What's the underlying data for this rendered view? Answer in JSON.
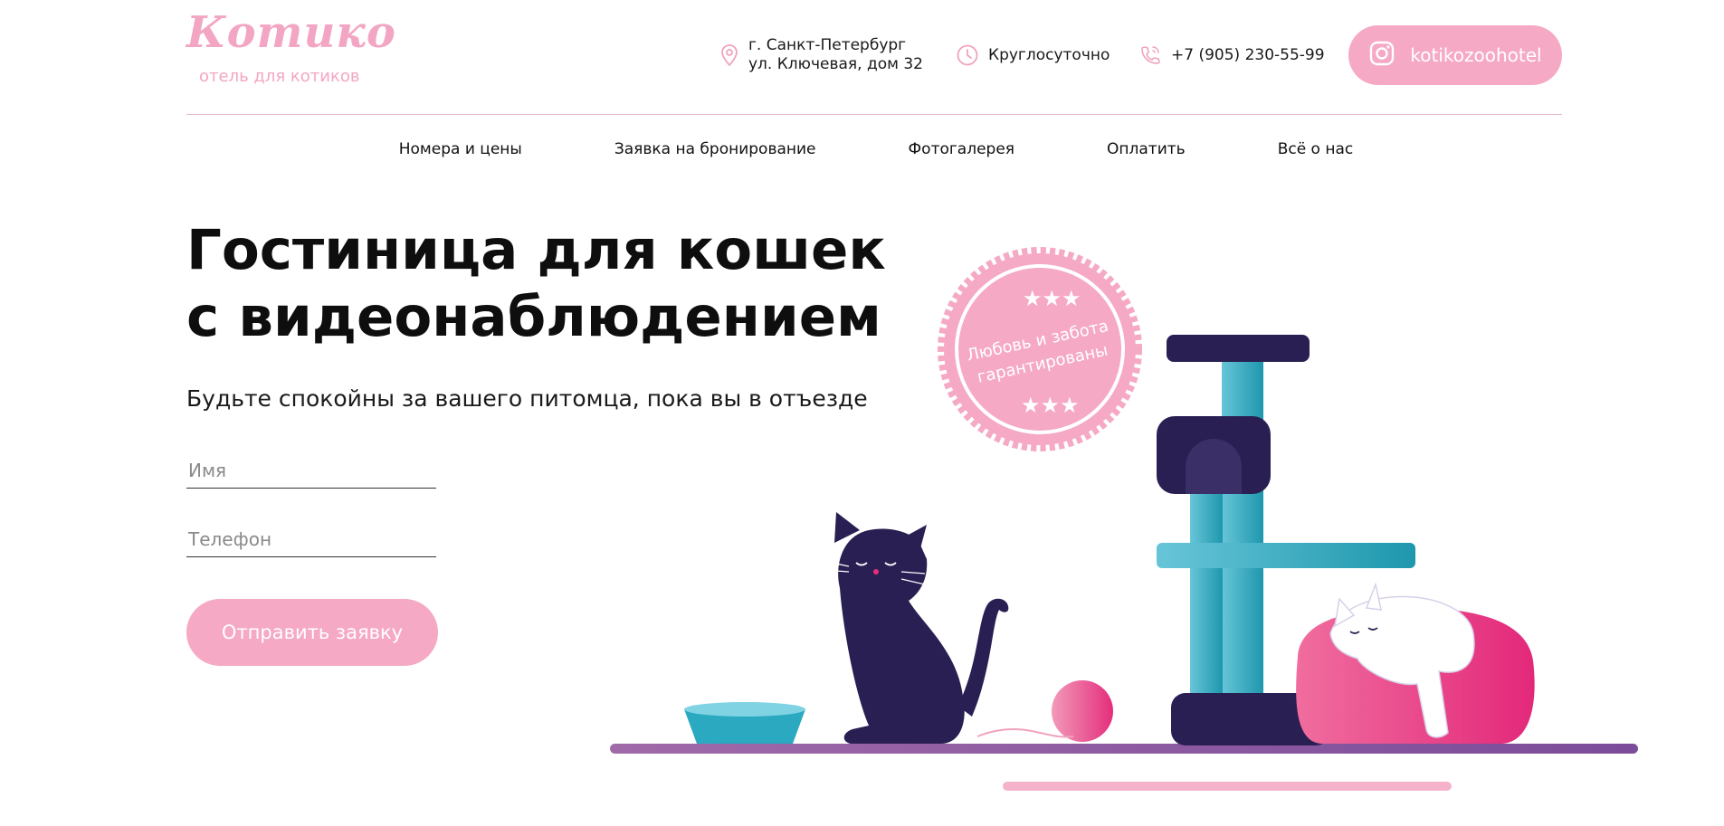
{
  "header": {
    "logo_title": "Котико",
    "logo_subtitle": "отель для котиков",
    "address_line1": "г. Санкт-Петербург",
    "address_line2": "ул. Ключевая, дом 32",
    "hours": "Круглосуточно",
    "phone": "+7 (905) 230-55-99",
    "instagram": "kotikozoohotel"
  },
  "nav": {
    "items": [
      "Номера и цены",
      "Заявка на бронирование",
      "Фотогалерея",
      "Оплатить",
      "Всё о нас"
    ]
  },
  "hero": {
    "title_line1": "Гостиница для кошек",
    "title_line2": "с видеонаблюдением",
    "subtitle": "Будьте спокойны за вашего питомца, пока вы в отъезде"
  },
  "form": {
    "name_placeholder": "Имя",
    "phone_placeholder": "Телефон",
    "submit_label": "Отправить заявку"
  },
  "badge": {
    "line1": "Любовь и забота",
    "line2": "гарантированы"
  },
  "colors": {
    "brand_pink": "#f5a9c5",
    "text_dark": "#0e0e0e",
    "navy": "#2a1f52",
    "teal": "#3fb2c9",
    "magenta": "#e72e7e"
  }
}
